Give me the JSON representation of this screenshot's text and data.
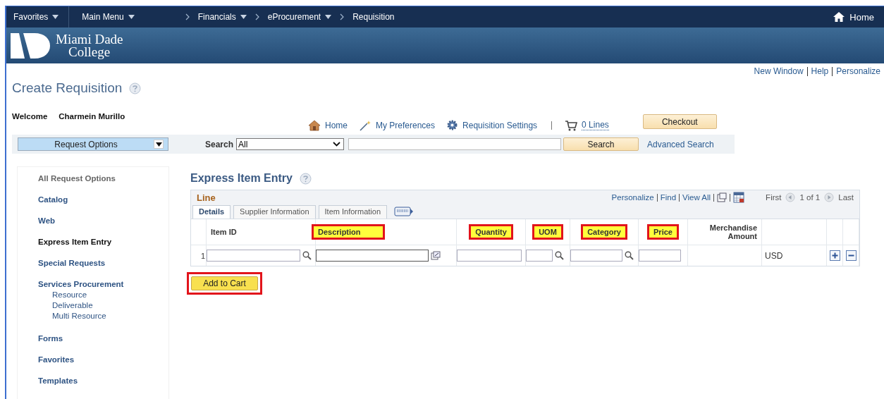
{
  "nav": {
    "items": [
      {
        "label": "Favorites",
        "dropdown": true
      },
      {
        "label": "Main Menu",
        "dropdown": true
      },
      {
        "label": "Financials",
        "dropdown": true
      },
      {
        "label": "eProcurement",
        "dropdown": true
      },
      {
        "label": "Requisition",
        "dropdown": false
      }
    ],
    "home": "Home"
  },
  "banner": {
    "logo_line_1": "Miami Dade",
    "logo_line_2": "College"
  },
  "header_links": [
    "New Window",
    "Help",
    "Personalize"
  ],
  "page_title": "Create Requisition",
  "welcome": {
    "label": "Welcome",
    "name": "Charmein Murillo"
  },
  "toolbar": {
    "links": [
      {
        "kind": "home",
        "label": "Home"
      },
      {
        "kind": "preferences",
        "label": "My Preferences"
      },
      {
        "kind": "settings",
        "label": "Requisition Settings"
      }
    ],
    "cart": "0 Lines",
    "checkout": "Checkout"
  },
  "search": {
    "request_options": "Request Options",
    "label": "Search",
    "category": "All",
    "button": "Search",
    "advanced": "Advanced Search"
  },
  "sidebar": {
    "items": [
      {
        "label": "All Request Options",
        "kind": "heading",
        "selected": false
      },
      {
        "label": "Catalog",
        "kind": "link",
        "selected": false
      },
      {
        "label": "Web",
        "kind": "link",
        "selected": false
      },
      {
        "label": "Express Item Entry",
        "kind": "link",
        "selected": true
      },
      {
        "label": "Special Requests",
        "kind": "link",
        "selected": false
      },
      {
        "label": "Services Procurement",
        "kind": "link",
        "selected": false,
        "children": [
          {
            "label": "Resource",
            "selected": false
          },
          {
            "label": "Deliverable",
            "selected": false
          },
          {
            "label": "Multi Resource",
            "selected": false
          }
        ]
      },
      {
        "label": "Forms",
        "kind": "link",
        "selected": false
      },
      {
        "label": "Favorites",
        "kind": "link",
        "selected": false
      },
      {
        "label": "Templates",
        "kind": "link",
        "selected": false
      }
    ]
  },
  "section_title": "Express Item Entry",
  "grid": {
    "title": "Line",
    "links": [
      "Personalize",
      "Find",
      "View All"
    ],
    "pager": {
      "first": "First",
      "range": "1 of 1",
      "last": "Last"
    },
    "tabs": [
      {
        "label": "Details",
        "selected": true
      },
      {
        "label": "Supplier Information",
        "selected": false
      },
      {
        "label": "Item Information",
        "selected": false
      }
    ],
    "columns": [
      {
        "label": "Item ID",
        "kind": "lookup",
        "highlighted": false
      },
      {
        "label": "Description",
        "kind": "expand",
        "highlighted": true
      },
      {
        "label": "Quantity",
        "kind": "text",
        "highlighted": true
      },
      {
        "label": "UOM",
        "kind": "lookup",
        "highlighted": true
      },
      {
        "label": "Category",
        "kind": "lookup",
        "highlighted": true
      },
      {
        "label": "Price",
        "kind": "text",
        "highlighted": true
      },
      {
        "label": "Merchandise Amount",
        "kind": "amount",
        "highlighted": false
      }
    ],
    "rows": [
      {
        "number": "1",
        "currency": "USD"
      }
    ]
  },
  "add_to_cart": {
    "label": "Add to Cart",
    "highlighted": true
  }
}
